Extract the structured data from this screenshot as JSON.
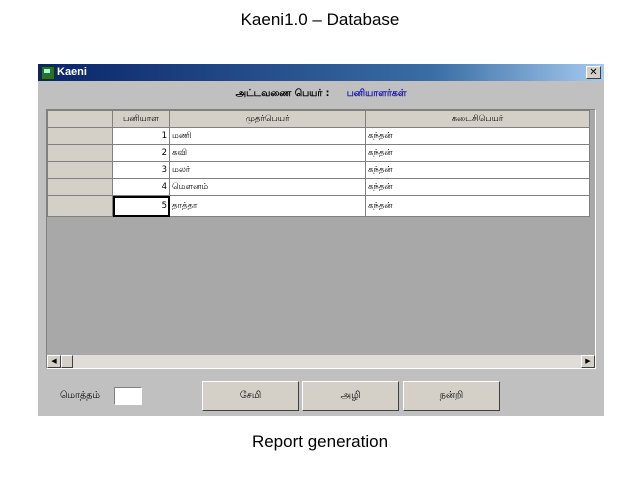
{
  "slide": {
    "title": "Kaeni1.0 – Database",
    "caption": "Report generation"
  },
  "window": {
    "title": "Kaeni",
    "close_glyph": "✕"
  },
  "form": {
    "table_name_label": "அட்டவணை பெயர் :",
    "table_name_value": "பனியாளர்கள்"
  },
  "grid": {
    "columns": [
      "",
      "பனியாள",
      "முதர்பெயர்",
      "கடைசிபெயர்"
    ],
    "rows": [
      {
        "id": "1",
        "first": "மணி",
        "last": "கந்தன்"
      },
      {
        "id": "2",
        "first": "கவி",
        "last": "கந்தன்"
      },
      {
        "id": "3",
        "first": "மலர்",
        "last": "கந்தன்"
      },
      {
        "id": "4",
        "first": "மௌனம்",
        "last": "கந்தன்"
      },
      {
        "id": "5",
        "first": "தாத்தா",
        "last": "கந்தன்"
      }
    ],
    "scroll_left": "◀",
    "scroll_right": "▶"
  },
  "footer": {
    "total_label": "மொத்தம்",
    "total_value": "",
    "save_label": "சேமி",
    "delete_label": "அழி",
    "thanks_label": "நன்றி"
  }
}
